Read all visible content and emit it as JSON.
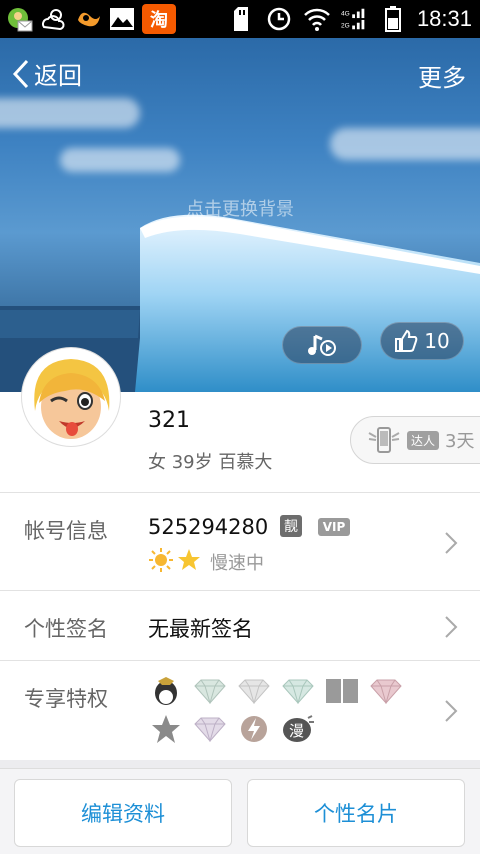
{
  "status_bar": {
    "time": "18:31",
    "left_icons": [
      "contact-mail-icon",
      "weather-icon",
      "uc-browser-icon",
      "gallery-icon",
      "taobao-icon"
    ],
    "taobao_label": "淘",
    "right_icons": [
      "sd-card-icon",
      "alarm-clock-icon",
      "wifi-icon",
      "signal-icon",
      "battery-icon"
    ],
    "network": [
      "4G",
      "2G"
    ]
  },
  "header": {
    "back_label": "返回",
    "more_label": "更多",
    "cover_hint": "点击更换背景",
    "like_count": "10"
  },
  "profile": {
    "nickname": "321",
    "subtitle": "女 39岁 百慕大",
    "daren_tag": "达人",
    "daren_days": "3天"
  },
  "account": {
    "label": "帐号信息",
    "number": "525294280",
    "liang_badge": "靓",
    "vip_badge": "VIP",
    "speed_text": "慢速中"
  },
  "signature": {
    "label": "个性签名",
    "value": "无最新签名"
  },
  "privileges": {
    "label": "专享特权",
    "badges": [
      "qq-penguin-icon",
      "diamond-icon",
      "diamond-icon",
      "diamond-icon",
      "book-icon",
      "pink-diamond-icon",
      "star-icon",
      "purple-diamond-icon",
      "lightning-icon",
      "comic-icon"
    ]
  },
  "actions": {
    "edit_label": "编辑资料",
    "card_label": "个性名片"
  },
  "colors": {
    "accent": "#1d8fd6",
    "taobao": "#f55a00"
  }
}
